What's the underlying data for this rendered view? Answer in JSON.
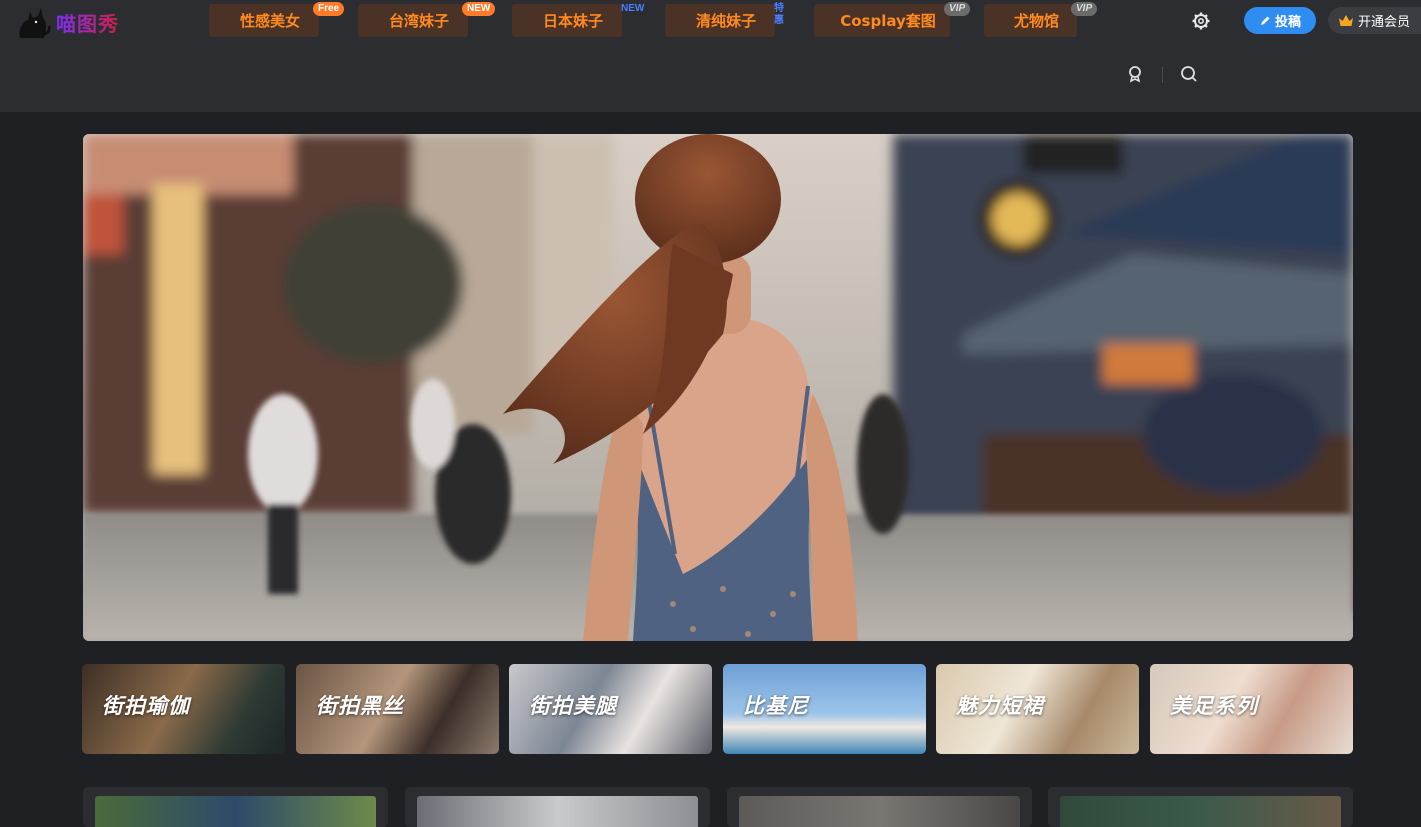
{
  "header": {
    "logo_text": "喵图秀",
    "nav": [
      {
        "label": "性感美女",
        "badge": "Free"
      },
      {
        "label": "台湾妹子",
        "badge": "NEW"
      },
      {
        "label": "日本妹子",
        "badge": "NEW"
      },
      {
        "label": "清纯妹子",
        "badge": "特惠"
      },
      {
        "label": "Cosplay套图",
        "badge": "VIP"
      },
      {
        "label": "尤物馆",
        "badge": "VIP"
      }
    ],
    "submit_label": "投稿",
    "vip_label": "开通会员"
  },
  "icons": {
    "logo": "cat-logo-icon",
    "settings": "gear-icon",
    "submit": "pencil-icon",
    "vip": "crown-icon",
    "user": "user-icon",
    "search": "search-icon"
  },
  "categories": [
    {
      "label": "街拍瑜伽"
    },
    {
      "label": "街拍黑丝"
    },
    {
      "label": "街拍美腿"
    },
    {
      "label": "比基尼"
    },
    {
      "label": "魅力短裙"
    },
    {
      "label": "美足系列"
    }
  ],
  "colors": {
    "page_bg": "#1f2023",
    "header_bg": "#2c2d31",
    "nav_text": "#ff8a1f",
    "nav_bg": "#4a3227",
    "accent_blue": "#2f8cf0"
  }
}
